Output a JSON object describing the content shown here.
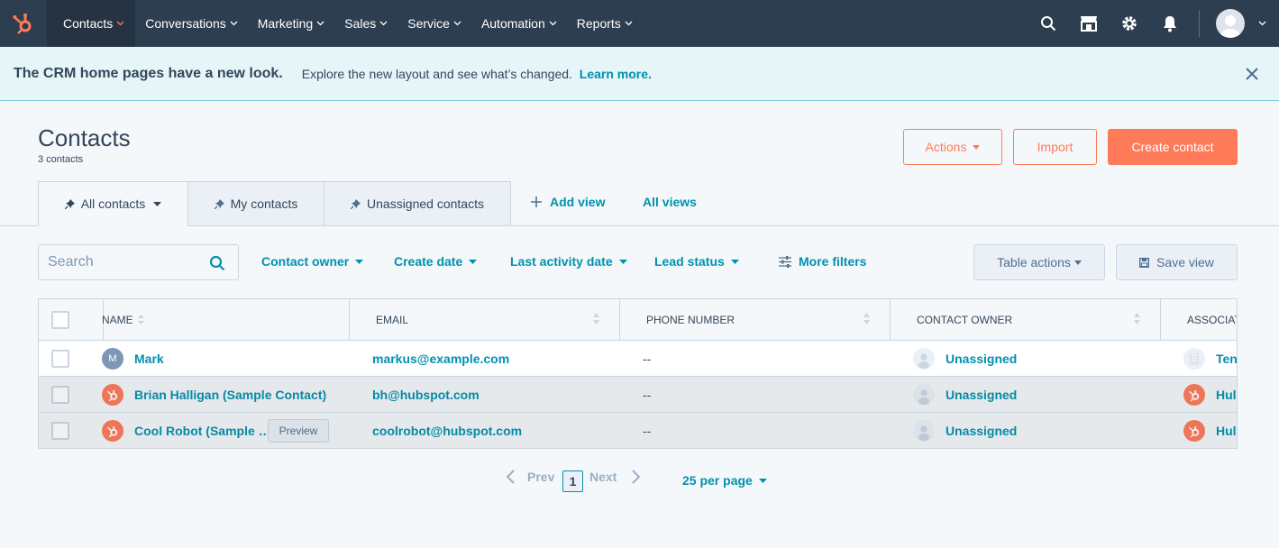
{
  "nav": {
    "items": [
      {
        "label": "Contacts"
      },
      {
        "label": "Conversations"
      },
      {
        "label": "Marketing"
      },
      {
        "label": "Sales"
      },
      {
        "label": "Service"
      },
      {
        "label": "Automation"
      },
      {
        "label": "Reports"
      }
    ]
  },
  "banner": {
    "title": "The CRM home pages have a new look.",
    "text": "Explore the new layout and see what’s changed.",
    "link": "Learn more."
  },
  "header": {
    "title": "Contacts",
    "count": "3 contacts",
    "actions_label": "Actions",
    "import_label": "Import",
    "create_label": "Create contact"
  },
  "tabs": {
    "all": "All contacts",
    "mine": "My contacts",
    "unassigned": "Unassigned contacts",
    "add_view": "Add view",
    "all_views": "All views"
  },
  "filters": {
    "search_placeholder": "Search",
    "contact_owner": "Contact owner",
    "create_date": "Create date",
    "last_activity": "Last activity date",
    "lead_status": "Lead status",
    "more_filters": "More filters",
    "table_actions": "Table actions",
    "save_view": "Save view"
  },
  "table": {
    "columns": [
      "NAME",
      "EMAIL",
      "PHONE NUMBER",
      "CONTACT OWNER",
      "ASSOCIAT"
    ],
    "rows": [
      {
        "initial": "M",
        "name": "Mark",
        "email": "markus@example.com",
        "phone": "--",
        "owner": "Unassigned",
        "assoc": "Ten"
      },
      {
        "initial": "",
        "name": "Brian Halligan (Sample Contact)",
        "email": "bh@hubspot.com",
        "phone": "--",
        "owner": "Unassigned",
        "assoc": "Hul"
      },
      {
        "initial": "",
        "name": "Cool Robot (Sample …",
        "email": "coolrobot@hubspot.com",
        "phone": "--",
        "owner": "Unassigned",
        "assoc": "Hul",
        "preview": "Preview"
      }
    ]
  },
  "pagination": {
    "prev": "Prev",
    "page": "1",
    "next": "Next",
    "per_page": "25 per page"
  }
}
